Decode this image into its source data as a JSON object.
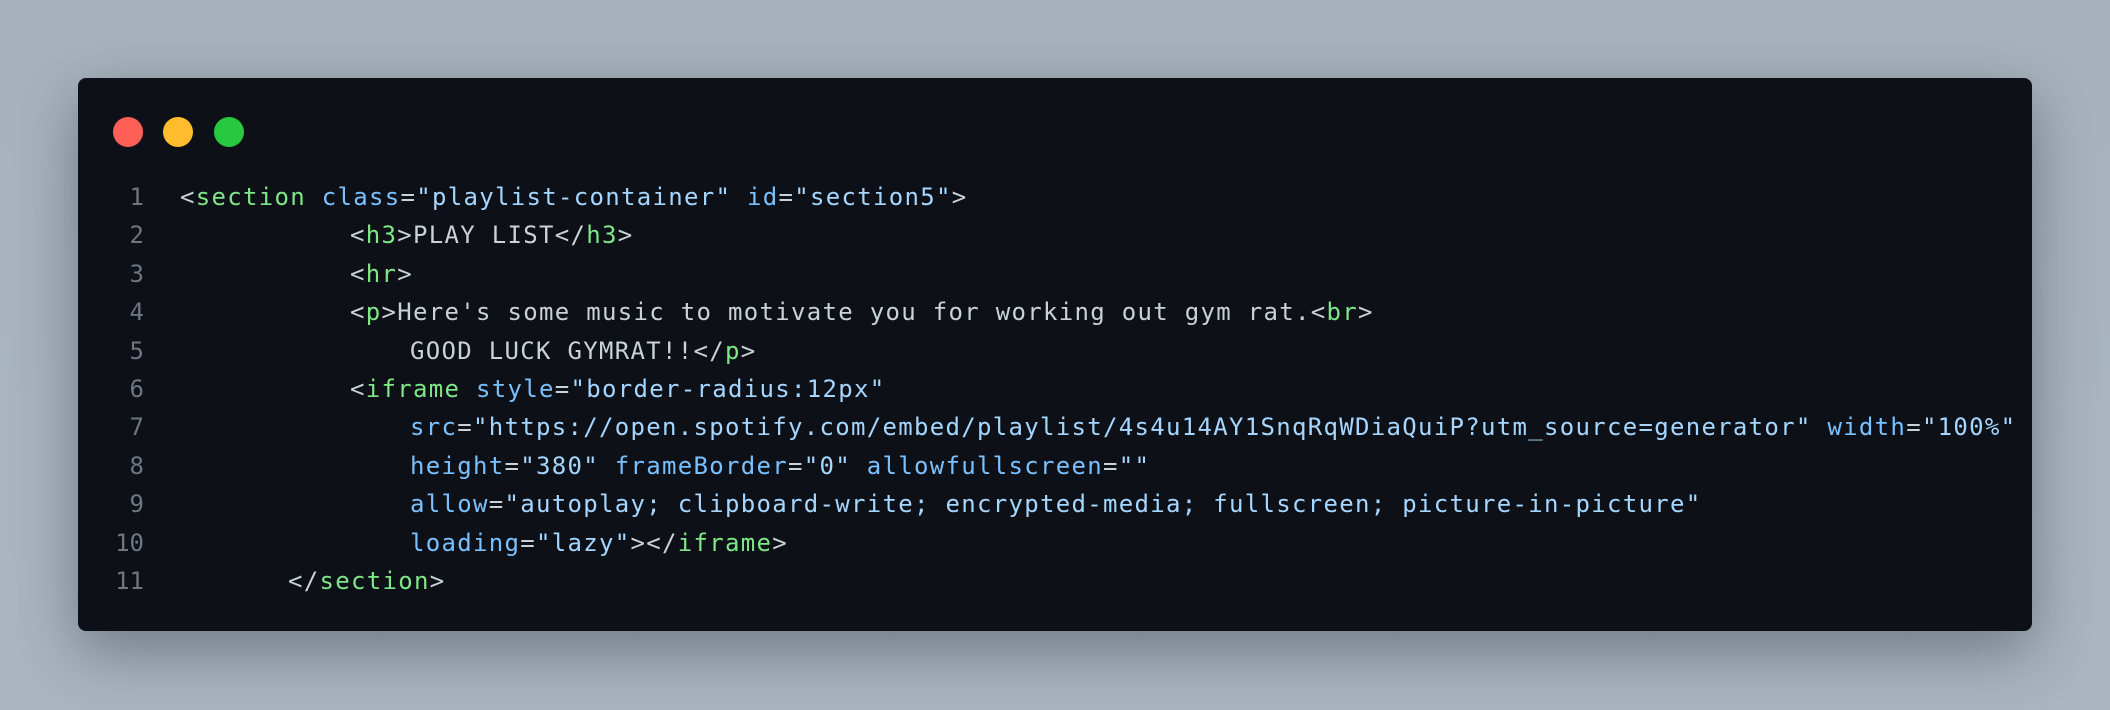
{
  "window": {
    "controls": [
      "close",
      "minimize",
      "maximize"
    ],
    "colors": {
      "close": "#ff5f56",
      "minimize": "#ffbd2e",
      "maximize": "#27c93f",
      "background": "#0d1117"
    }
  },
  "code": {
    "lines": [
      {
        "n": "1",
        "indent": 0,
        "tokens": [
          [
            "pu",
            "<"
          ],
          [
            "tg",
            "section"
          ],
          [
            "tx",
            " "
          ],
          [
            "at",
            "class"
          ],
          [
            "pu",
            "="
          ],
          [
            "st",
            "\"playlist-container\""
          ],
          [
            "tx",
            " "
          ],
          [
            "at",
            "id"
          ],
          [
            "pu",
            "="
          ],
          [
            "st",
            "\"section5\""
          ],
          [
            "pu",
            ">"
          ]
        ]
      },
      {
        "n": "2",
        "indent": 2,
        "tokens": [
          [
            "pu",
            "<"
          ],
          [
            "tg",
            "h3"
          ],
          [
            "pu",
            ">"
          ],
          [
            "tx",
            "PLAY LIST"
          ],
          [
            "pu",
            "</"
          ],
          [
            "tg",
            "h3"
          ],
          [
            "pu",
            ">"
          ]
        ]
      },
      {
        "n": "3",
        "indent": 2,
        "tokens": [
          [
            "pu",
            "<"
          ],
          [
            "tg",
            "hr"
          ],
          [
            "pu",
            ">"
          ]
        ]
      },
      {
        "n": "4",
        "indent": 2,
        "tokens": [
          [
            "pu",
            "<"
          ],
          [
            "tg",
            "p"
          ],
          [
            "pu",
            ">"
          ],
          [
            "tx",
            "Here's some music to motivate you for working out gym rat."
          ],
          [
            "pu",
            "<"
          ],
          [
            "tg",
            "br"
          ],
          [
            "pu",
            ">"
          ]
        ]
      },
      {
        "n": "5",
        "indent": 3,
        "tokens": [
          [
            "tx",
            "GOOD LUCK GYMRAT!!"
          ],
          [
            "pu",
            "</"
          ],
          [
            "tg",
            "p"
          ],
          [
            "pu",
            ">"
          ]
        ]
      },
      {
        "n": "6",
        "indent": 2,
        "tokens": [
          [
            "pu",
            "<"
          ],
          [
            "tg",
            "iframe"
          ],
          [
            "tx",
            " "
          ],
          [
            "at",
            "style"
          ],
          [
            "pu",
            "="
          ],
          [
            "st",
            "\"border-radius:12px\""
          ]
        ]
      },
      {
        "n": "7",
        "indent": 3,
        "tokens": [
          [
            "at",
            "src"
          ],
          [
            "pu",
            "="
          ],
          [
            "st",
            "\"https://open.spotify.com/embed/playlist/4s4u14AY1SnqRqWDiaQuiP?utm_source=generator\""
          ],
          [
            "tx",
            " "
          ],
          [
            "at",
            "width"
          ],
          [
            "pu",
            "="
          ],
          [
            "st",
            "\"100%\""
          ]
        ]
      },
      {
        "n": "8",
        "indent": 3,
        "tokens": [
          [
            "at",
            "height"
          ],
          [
            "pu",
            "="
          ],
          [
            "st",
            "\"380\""
          ],
          [
            "tx",
            " "
          ],
          [
            "at",
            "frameBorder"
          ],
          [
            "pu",
            "="
          ],
          [
            "st",
            "\"0\""
          ],
          [
            "tx",
            " "
          ],
          [
            "at",
            "allowfullscreen"
          ],
          [
            "pu",
            "="
          ],
          [
            "st",
            "\"\""
          ]
        ]
      },
      {
        "n": "9",
        "indent": 3,
        "tokens": [
          [
            "at",
            "allow"
          ],
          [
            "pu",
            "="
          ],
          [
            "st",
            "\"autoplay; clipboard-write; encrypted-media; fullscreen; picture-in-picture\""
          ]
        ]
      },
      {
        "n": "10",
        "indent": 3,
        "tokens": [
          [
            "at",
            "loading"
          ],
          [
            "pu",
            "="
          ],
          [
            "st",
            "\"lazy\""
          ],
          [
            "pu",
            "></"
          ],
          [
            "tg",
            "iframe"
          ],
          [
            "pu",
            ">"
          ]
        ]
      },
      {
        "n": "11",
        "indent": 1,
        "tokens": [
          [
            "pu",
            "</"
          ],
          [
            "tg",
            "section"
          ],
          [
            "pu",
            ">"
          ]
        ]
      }
    ]
  }
}
